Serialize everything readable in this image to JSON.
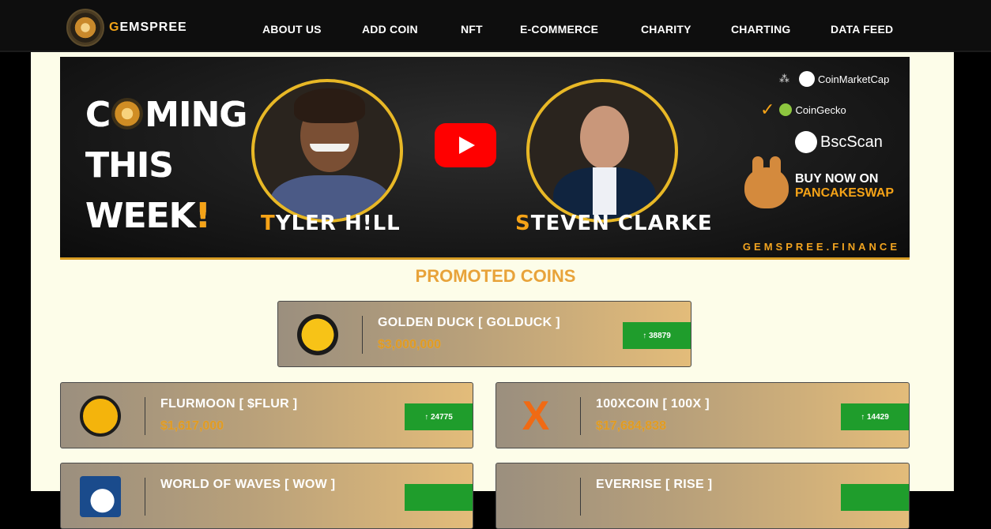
{
  "nav": {
    "logo_prefix": "G",
    "logo_rest": "EMSPREE",
    "items": [
      {
        "label": "ABOUT US"
      },
      {
        "label": "ADD COIN"
      },
      {
        "label": "NFT"
      },
      {
        "label": "E-COMMERCE"
      },
      {
        "label": "CHARITY"
      },
      {
        "label": "CHARTING"
      },
      {
        "label": "DATA FEED"
      }
    ]
  },
  "banner": {
    "coming_c": "C",
    "coming_rest": "MING",
    "this": "THIS",
    "week": "WEEK",
    "bang": "!",
    "person1_first": "T",
    "person1_rest": "YLER H!LL",
    "person2_first": "S",
    "person2_rest": "TEVEN CLARKE",
    "coinmarketcap": "CoinMarketCap",
    "coingecko": "CoinGecko",
    "bscscan": "BscScan",
    "buy_now": "BUY NOW ON",
    "pancakeswap": "PANCAKESWAP",
    "site": "GEMSPREE.FINANCE"
  },
  "promoted": {
    "title": "PROMOTED COINS",
    "coins": [
      {
        "name": "GOLDEN DUCK [ GOLDUCK ]",
        "cap": "$3,000,000",
        "votes": "↑ 38879",
        "icon": "golden-duck-logo"
      },
      {
        "name": "FLURMOON [ $FLUR ]",
        "cap": "$1,617,000",
        "votes": "↑ 24775",
        "icon": "flurmoon-logo"
      },
      {
        "name": "100XCOIN [ 100X ]",
        "cap": "$17,684,838",
        "votes": "↑ 14429",
        "icon": "100xcoin-logo"
      },
      {
        "name": "WORLD OF WAVES [ WOW ]",
        "cap": "",
        "votes": "",
        "icon": "world-of-waves-logo"
      },
      {
        "name": "EVERRISE [ RISE ]",
        "cap": "",
        "votes": "",
        "icon": "everrise-logo"
      }
    ]
  }
}
